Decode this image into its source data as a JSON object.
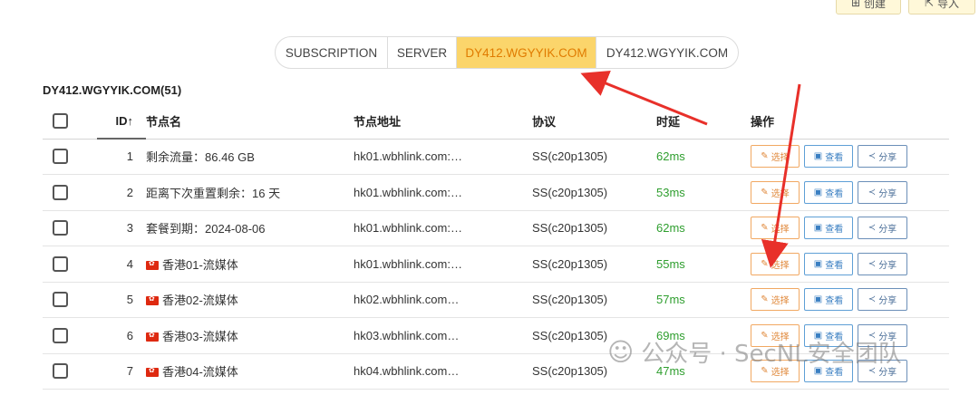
{
  "toolbar": {
    "create_label": "创建",
    "import_label": "导入"
  },
  "tabs": [
    {
      "label": "SUBSCRIPTION",
      "active": false
    },
    {
      "label": "SERVER",
      "active": false
    },
    {
      "label": "DY412.WGYYIK.COM",
      "active": true
    },
    {
      "label": "DY412.WGYYIK.COM",
      "active": false
    }
  ],
  "group_title": "DY412.WGYYIK.COM(51)",
  "table": {
    "headers": {
      "id": "ID",
      "name": "节点名",
      "address": "节点地址",
      "protocol": "协议",
      "latency": "时延",
      "actions": "操作"
    },
    "sort_indicator": "↑",
    "rows": [
      {
        "id": "1",
        "flag": false,
        "name": "剩余流量：86.46 GB",
        "address": "hk01.wbhlink.com:…",
        "protocol": "SS(c20p1305)",
        "latency": "62ms"
      },
      {
        "id": "2",
        "flag": false,
        "name": "距离下次重置剩余：16 天",
        "address": "hk01.wbhlink.com:…",
        "protocol": "SS(c20p1305)",
        "latency": "53ms"
      },
      {
        "id": "3",
        "flag": false,
        "name": "套餐到期：2024-08-06",
        "address": "hk01.wbhlink.com:…",
        "protocol": "SS(c20p1305)",
        "latency": "62ms"
      },
      {
        "id": "4",
        "flag": true,
        "name": "香港01-流媒体",
        "address": "hk01.wbhlink.com:…",
        "protocol": "SS(c20p1305)",
        "latency": "55ms"
      },
      {
        "id": "5",
        "flag": true,
        "name": "香港02-流媒体",
        "address": "hk02.wbhlink.com…",
        "protocol": "SS(c20p1305)",
        "latency": "57ms"
      },
      {
        "id": "6",
        "flag": true,
        "name": "香港03-流媒体",
        "address": "hk03.wbhlink.com…",
        "protocol": "SS(c20p1305)",
        "latency": "69ms"
      },
      {
        "id": "7",
        "flag": true,
        "name": "香港04-流媒体",
        "address": "hk04.wbhlink.com…",
        "protocol": "SS(c20p1305)",
        "latency": "47ms"
      }
    ],
    "actions": {
      "select": "选择",
      "view": "查看",
      "share": "分享"
    }
  },
  "watermark": {
    "text": "公众号 · SecNL安全团队"
  },
  "colors": {
    "accent_tab": "#fbd56b",
    "latency": "#2e9e2e",
    "arrow": "#e8302a"
  }
}
